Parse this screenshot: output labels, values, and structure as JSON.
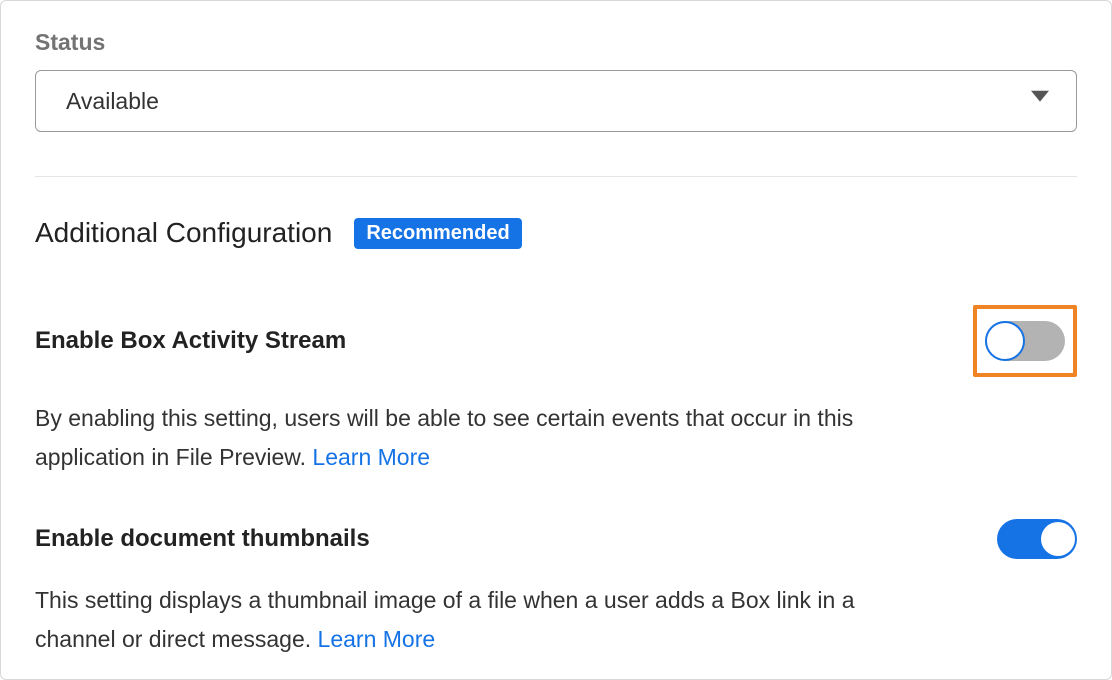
{
  "status": {
    "label": "Status",
    "selected": "Available"
  },
  "section": {
    "title": "Additional Configuration",
    "badge": "Recommended"
  },
  "settings": [
    {
      "title": "Enable Box Activity Stream",
      "description": "By enabling this setting, users will be able to see certain events that occur in this application in File Preview. ",
      "learn_more": "Learn More",
      "enabled": false,
      "highlighted": true
    },
    {
      "title": "Enable document thumbnails",
      "description": "This setting displays a thumbnail image of a file when a user adds a Box link in a channel or direct message. ",
      "learn_more": "Learn More",
      "enabled": true,
      "highlighted": false
    }
  ]
}
